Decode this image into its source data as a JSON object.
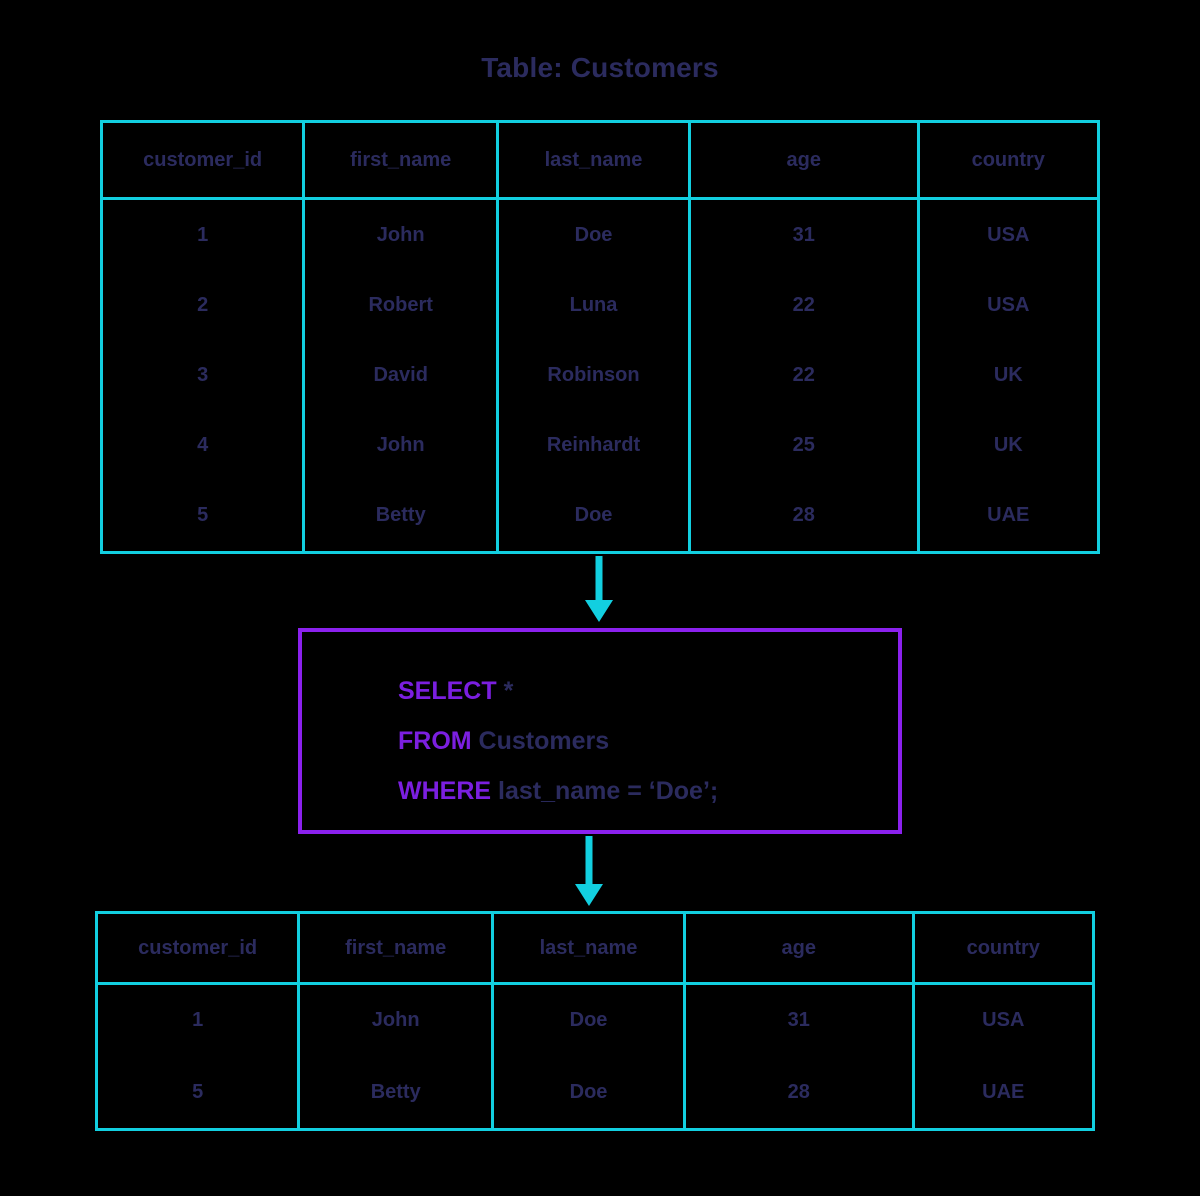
{
  "title": "Table: Customers",
  "colors": {
    "table_border": "#12cfe0",
    "text": "#2b2b5e",
    "query_border": "#8b21ee",
    "keyword": "#7b1fe0",
    "arrow": "#12cfe0",
    "background": "#000000"
  },
  "source_table": {
    "name": "Customers",
    "columns": [
      "customer_id",
      "first_name",
      "last_name",
      "age",
      "country"
    ],
    "rows": [
      [
        "1",
        "John",
        "Doe",
        "31",
        "USA"
      ],
      [
        "2",
        "Robert",
        "Luna",
        "22",
        "USA"
      ],
      [
        "3",
        "David",
        "Robinson",
        "22",
        "UK"
      ],
      [
        "4",
        "John",
        "Reinhardt",
        "25",
        "UK"
      ],
      [
        "5",
        "Betty",
        "Doe",
        "28",
        "UAE"
      ]
    ]
  },
  "query": {
    "lines": [
      {
        "keyword": "SELECT",
        "rest": " *"
      },
      {
        "keyword": "FROM",
        "rest": " Customers"
      },
      {
        "keyword": "WHERE",
        "rest": " last_name = ‘Doe’;"
      }
    ],
    "full_text": "SELECT * FROM Customers WHERE last_name = ‘Doe’;"
  },
  "result_table": {
    "columns": [
      "customer_id",
      "first_name",
      "last_name",
      "age",
      "country"
    ],
    "rows": [
      [
        "1",
        "John",
        "Doe",
        "31",
        "USA"
      ],
      [
        "5",
        "Betty",
        "Doe",
        "28",
        "UAE"
      ]
    ]
  },
  "arrows": [
    {
      "name": "source-to-query",
      "direction": "down"
    },
    {
      "name": "query-to-result",
      "direction": "down"
    }
  ]
}
